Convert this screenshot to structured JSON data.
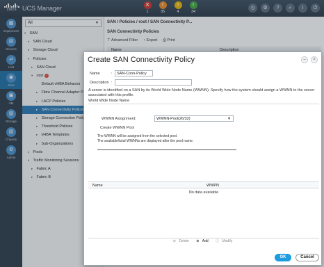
{
  "header": {
    "logo_text": "cisco",
    "app_title": "UCS Manager",
    "faults": [
      {
        "count": "1",
        "color": "#d9342b",
        "icon": "critical-fault-icon",
        "glyph": "✕"
      },
      {
        "count": "35",
        "color": "#f08a24",
        "icon": "major-fault-icon",
        "glyph": "!"
      },
      {
        "count": "4",
        "color": "#e9b800",
        "icon": "minor-fault-icon",
        "glyph": "!"
      },
      {
        "count": "34",
        "color": "#42a940",
        "icon": "warning-fault-icon",
        "glyph": "!"
      }
    ],
    "toolbar_icons": [
      "pending-activities-icon",
      "settings-icon",
      "help-icon",
      "search-icon",
      "info-icon",
      "logout-icon"
    ]
  },
  "rail": {
    "items": [
      {
        "label": "Equipment",
        "icon": "equipment-icon"
      },
      {
        "label": "Servers",
        "icon": "servers-icon"
      },
      {
        "label": "LAN",
        "icon": "lan-icon"
      },
      {
        "label": "SAN",
        "icon": "san-icon",
        "active": true
      },
      {
        "label": "VM",
        "icon": "vm-icon"
      },
      {
        "label": "Storage",
        "icon": "storage-icon"
      },
      {
        "label": "Chassis",
        "icon": "chassis-icon"
      },
      {
        "label": "Admin",
        "icon": "admin-icon"
      }
    ]
  },
  "tree": {
    "filter": "All",
    "items": [
      {
        "label": "SAN",
        "caret": "▾"
      },
      {
        "label": "SAN Cloud",
        "caret": "▸"
      },
      {
        "label": "Storage Cloud",
        "caret": "▸"
      },
      {
        "label": "Policies",
        "caret": "▾"
      },
      {
        "label": "SAN Cloud",
        "caret": "▸"
      },
      {
        "label": "root",
        "caret": "▾",
        "badge": true
      },
      {
        "label": "Default vHBA Behavior",
        "caret": ""
      },
      {
        "label": "Fibre Channel Adapter Polic",
        "caret": "▸"
      },
      {
        "label": "LACP Policies",
        "caret": "▸"
      },
      {
        "label": "SAN Connectivity Policies",
        "caret": "▸",
        "selected": true
      },
      {
        "label": "Storage Connection Policies",
        "caret": "▸"
      },
      {
        "label": "Threshold Policies",
        "caret": "▸"
      },
      {
        "label": "vHBA Templates",
        "caret": "▸"
      },
      {
        "label": "Sub-Organizations",
        "caret": "▸"
      },
      {
        "label": "Pools",
        "caret": "▸"
      },
      {
        "label": "Traffic Monitoring Sessions",
        "caret": "▾"
      },
      {
        "label": "Fabric A",
        "caret": "▸"
      },
      {
        "label": "Fabric B",
        "caret": "▸"
      }
    ]
  },
  "main": {
    "breadcrumb": "SAN / Policies / root / SAN Connectivity P...",
    "title": "SAN Connectivity Policies",
    "toolbar": {
      "filter": "⊤ Advanced Filter",
      "export": "↑ Export",
      "print": "⎙ Print"
    },
    "columns": {
      "name": "Name",
      "description": "Description"
    }
  },
  "dialog": {
    "title": "Create SAN Connectivity Policy",
    "name_label": "Name",
    "name_sep": ":",
    "name_value": "SAN-Conn-Policy",
    "description_label": "Description",
    "description_sep": ":",
    "description_value": "",
    "info_text": "A server is identified on a SAN by its World Wide Node Name (WWNN). Specify how the system should assign a WWNN to the server associated with this profile.",
    "section_title": "World Wide Node Name",
    "wwnn_label": "WWNN Assignment:",
    "wwnn_value": "WWNN-Pool(26/32)",
    "create_pool_link": "Create WWNN Pool",
    "note_line1": "The WWNN will be assigned from the selected pool.",
    "note_line2": "The available/total WWNNs are displayed after the pool name.",
    "table": {
      "col_name": "Name",
      "col_wwpn": "WWPN",
      "empty": "No data available"
    },
    "actions": {
      "delete": "Delete",
      "add": "Add",
      "modify": "Modify"
    },
    "ok_label": "OK",
    "cancel_label": "Cancel",
    "minimize_glyph": "–",
    "close_glyph": "×"
  }
}
